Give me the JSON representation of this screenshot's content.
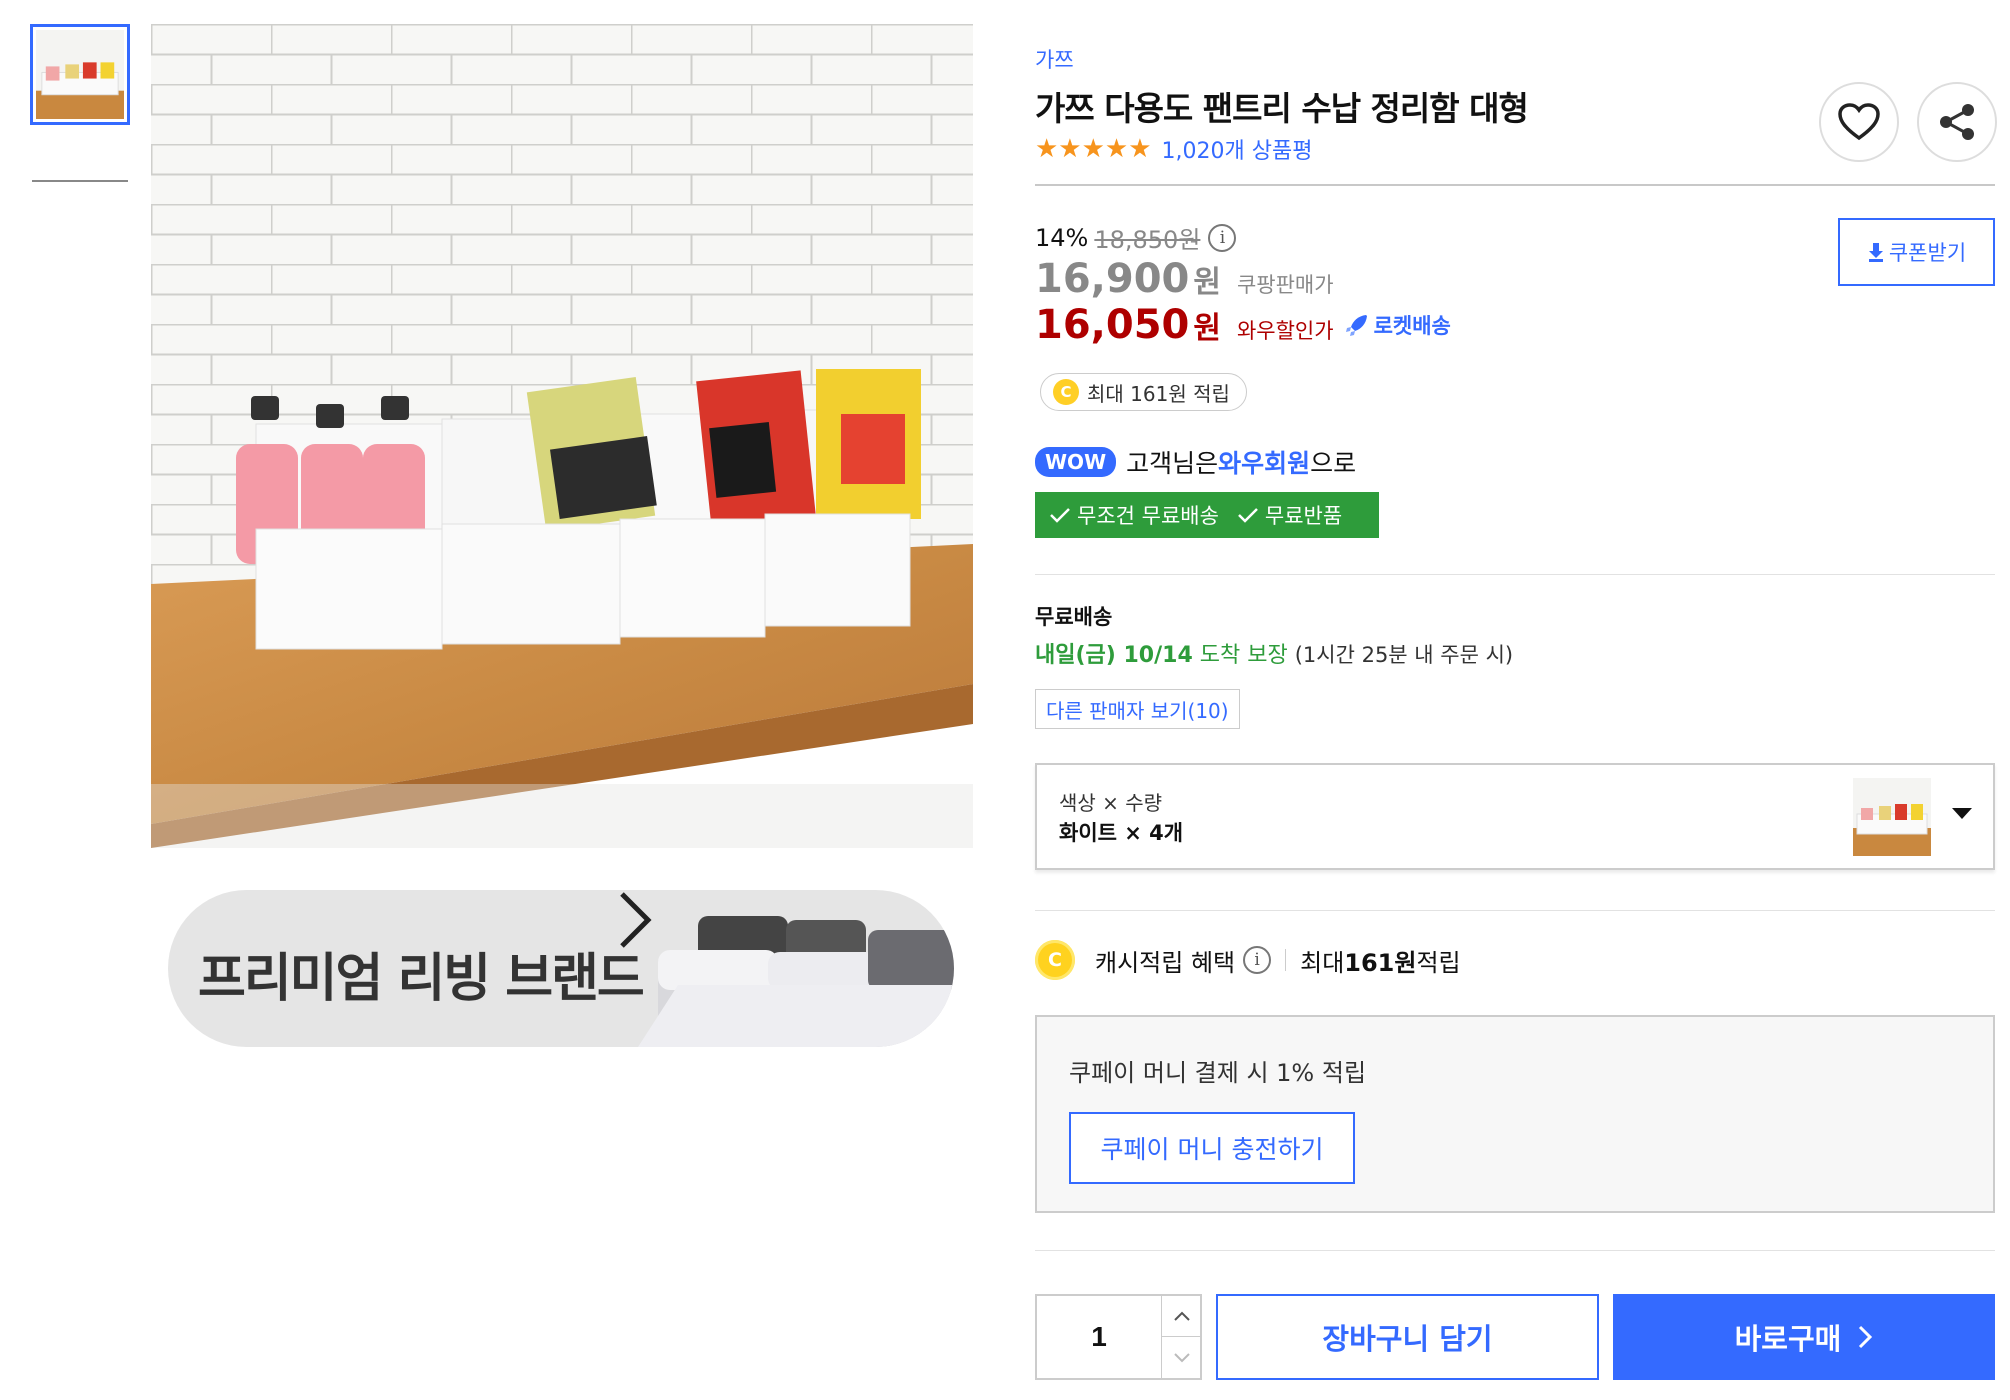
{
  "gallery": {
    "thumb_caption_icon": "text-lines",
    "banner_text": "프리미엄 리빙 브랜드",
    "banner_icon": "chevron-right-icon"
  },
  "product": {
    "brand": "가쯔",
    "title": "가쯔 다용도 팬트리 수납 정리함 대형",
    "rating_stars": "★★★★★",
    "rating_value": 5,
    "review_count": "1,020개 상품평"
  },
  "price": {
    "discount_rate": "14%",
    "original_price": "18,850원",
    "info_glyph": "i",
    "coupang_price": "16,900",
    "won": "원",
    "coupang_label": "쿠팡판매가",
    "wow_price": "16,050",
    "wow_label": "와우할인가",
    "rocket_label": "로켓배송",
    "coupon_button": "쿠폰받기",
    "cash_coin_glyph": "C",
    "cash_pill": "최대 161원 적립"
  },
  "wow": {
    "badge": "WOW",
    "prefix": "고객님은 ",
    "member": "와우회원",
    "suffix": "으로",
    "free_shipping": "무조건 무료배송",
    "free_return": "무료반품"
  },
  "shipping": {
    "title": "무료배송",
    "date": "내일(금) 10/14",
    "arrival": " 도착 보장 ",
    "condition": "(1시간 25분 내 주문 시)",
    "other_sellers": "다른 판매자 보기(10)"
  },
  "option": {
    "label": "색상 × 수량",
    "value": "화이트 × 4개"
  },
  "cash_benefit": {
    "coin_glyph": "C",
    "label": "캐시적립 혜택",
    "info_glyph": "i",
    "max_prefix": "최대 ",
    "amount": "161원",
    "max_suffix": " 적립"
  },
  "coupay": {
    "text": "쿠페이 머니 결제 시 1% 적립",
    "button": "쿠페이 머니 충전하기"
  },
  "purchase": {
    "quantity": "1",
    "add_to_cart": "장바구니 담기",
    "buy_now": "바로구매"
  },
  "colors": {
    "accent": "#346aff",
    "price_red": "#ae0000",
    "green": "#2e9c3b",
    "star": "#f7941d",
    "coin": "#ffcf26"
  }
}
